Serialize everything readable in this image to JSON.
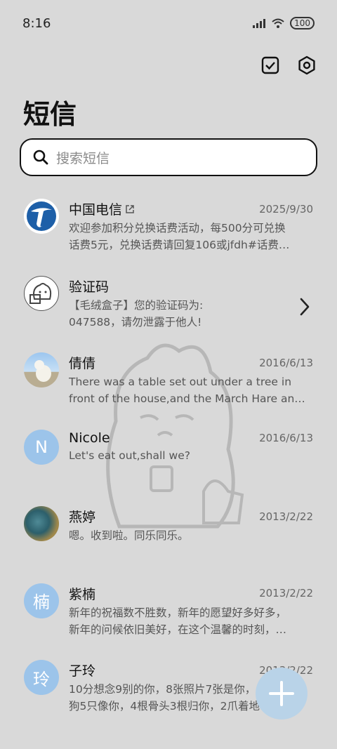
{
  "status": {
    "time": "8:16",
    "signal_icon": "signal-icon",
    "wifi_icon": "wifi-icon",
    "battery": "100"
  },
  "toolbar": {
    "select_icon": "checkbox-icon",
    "settings_icon": "settings-icon"
  },
  "page": {
    "title": "短信"
  },
  "search": {
    "placeholder": "搜索短信"
  },
  "messages": [
    {
      "sender": "中国电信",
      "date": "2025/9/30",
      "preview_line1": "欢迎参加积分兑换话费活动，每500分可兑换",
      "preview_line2": "话费5元，兑换话费请回复106或jfdh#话费…"
    },
    {
      "sender": "验证码",
      "date": "",
      "preview_line1": "【毛绒盒子】您的验证码为:",
      "preview_line2": "047588，请勿泄露于他人!"
    },
    {
      "sender": "倩倩",
      "date": "2016/6/13",
      "preview_line1": "There was a table set out under a tree in",
      "preview_line2": "front of the house,and the March Hare an…"
    },
    {
      "sender": "Nicole",
      "avatar_letter": "N",
      "date": "2016/6/13",
      "preview_line1": "Let's eat out,shall we?",
      "preview_line2": ""
    },
    {
      "sender": "燕婷",
      "date": "2013/2/22",
      "preview_line1": "嗯。收到啦。同乐同乐。",
      "preview_line2": ""
    },
    {
      "sender": "紫楠",
      "avatar_letter": "楠",
      "date": "2013/2/22",
      "preview_line1": "新年的祝福数不胜数，新年的愿望好多好多，",
      "preview_line2": "新年的问候依旧美好，在这个温馨的时刻，…"
    },
    {
      "sender": "子玲",
      "avatar_letter": "玲",
      "date": "2013/2/22",
      "preview_line1": "10分想念9别的你，8张照片7张是你，6只小",
      "preview_line2": "狗5只像你，4根骨头3根归你，2爪着地1定…"
    }
  ],
  "fab": {
    "icon": "plus-icon"
  },
  "colors": {
    "background": "#d9d9d9",
    "accent": "#9cc4ea",
    "fab": "#b9d3e8"
  }
}
